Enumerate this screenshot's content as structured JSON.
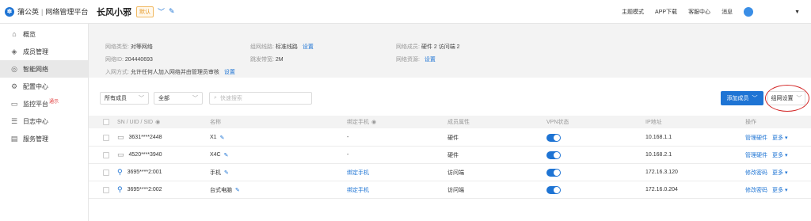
{
  "brand": {
    "name": "蒲公英",
    "sub": "网络管理平台"
  },
  "network": {
    "name": "长风小邪",
    "badge": "默认"
  },
  "topnav": {
    "theme": "主题模式",
    "app": "APP下载",
    "service": "客服中心",
    "msg": "消息"
  },
  "sidebar": {
    "items": [
      {
        "label": "概览",
        "icon": "home-icon"
      },
      {
        "label": "成员管理",
        "icon": "stack-icon"
      },
      {
        "label": "智能网络",
        "icon": "network-icon",
        "active": true
      },
      {
        "label": "配置中心",
        "icon": "gear-icon"
      },
      {
        "label": "监控平台",
        "icon": "monitor-icon",
        "sup": "通示"
      },
      {
        "label": "日志中心",
        "icon": "log-icon"
      },
      {
        "label": "服务管理",
        "icon": "service-icon"
      }
    ]
  },
  "info": {
    "type_label": "网络类型:",
    "type_value": "对等网络",
    "id_label": "网络ID:",
    "id_value": "204440693",
    "join_label": "入网方式:",
    "join_value": "允许任何人加入网络并由管理员审核",
    "join_link": "设置",
    "line_label": "组网线路:",
    "line_value": "标准线路",
    "line_link": "设置",
    "bw_label": "跳发带宽:",
    "bw_value": "2M",
    "members_label": "网络成员:",
    "members_value": "硬件 2   访问端 2",
    "res_label": "网络资源:",
    "res_link": "设置"
  },
  "filters": {
    "members": "所有成员",
    "all": "全部",
    "search_placeholder": "快速搜索"
  },
  "buttons": {
    "add": "添加成员",
    "settings": "组网设置"
  },
  "table": {
    "headers": {
      "sn": "SN / UID / SID",
      "name": "名称",
      "phone": "绑定手机",
      "attr": "成员属性",
      "vpn": "VPN状态",
      "ip": "IP地址",
      "ops": "操作"
    },
    "rows": [
      {
        "sn": "3631****2448",
        "name": "X1",
        "phone": "-",
        "attr": "硬件",
        "ip": "10.168.1.1",
        "op": "管理硬件",
        "more": "更多",
        "kind": "router"
      },
      {
        "sn": "4520****3940",
        "name": "X4C",
        "phone": "-",
        "attr": "硬件",
        "ip": "10.168.2.1",
        "op": "管理硬件",
        "more": "更多",
        "kind": "router"
      },
      {
        "sn": "3695****2:001",
        "name": "手机",
        "phone": "绑定手机",
        "attr": "访问端",
        "ip": "172.16.3.120",
        "op": "修改密码",
        "more": "更多",
        "kind": "person"
      },
      {
        "sn": "3695****2:002",
        "name": "台式电脑",
        "phone": "绑定手机",
        "attr": "访问端",
        "ip": "172.16.0.204",
        "op": "修改密码",
        "more": "更多",
        "kind": "person"
      }
    ]
  }
}
